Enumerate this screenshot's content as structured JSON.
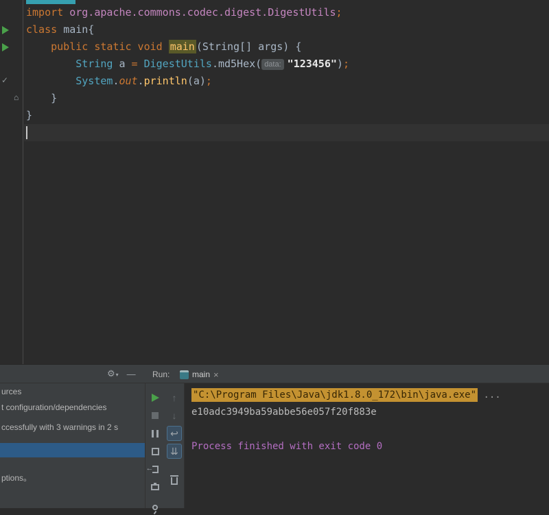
{
  "accent_colors": {
    "keyword": "#cc7832",
    "import_path": "#c586c0",
    "class_ref": "#52a5c0",
    "method": "#ffc66b",
    "run_green": "#4AA14A",
    "console_highlight_bg": "#c49231",
    "system_output_purple": "#b46ec2",
    "selection_blue": "#2d5b87",
    "active_tab_teal": "#36a0b0"
  },
  "editor": {
    "run_icon_lines": [
      1,
      2
    ],
    "gutter_marks": [
      {
        "line": 4,
        "icon": "check",
        "glyph": "✓"
      },
      {
        "line": 5,
        "icon": "bookmark",
        "glyph": "⌂"
      }
    ],
    "code_lines": [
      {
        "tokens": [
          [
            "kw",
            "import "
          ],
          [
            "imp",
            "org.apache.commons.codec.digest.DigestUtils"
          ],
          [
            "kw",
            ";"
          ]
        ]
      },
      {
        "tokens": [
          [
            "kw",
            "class "
          ],
          [
            "id",
            "main{"
          ]
        ]
      },
      {
        "tokens": [
          [
            "id",
            "    "
          ],
          [
            "kw",
            "public static void "
          ],
          [
            "decl",
            "main"
          ],
          [
            "id",
            "("
          ],
          [
            "id",
            "String[] args) {"
          ]
        ]
      },
      {
        "tokens": [
          [
            "id",
            "        "
          ],
          [
            "cls",
            "String"
          ],
          [
            "id",
            " a "
          ],
          [
            "kw",
            "= "
          ],
          [
            "cls",
            "DigestUtils"
          ],
          [
            "id",
            "."
          ],
          [
            "id",
            "md5Hex"
          ],
          [
            "id",
            "("
          ],
          [
            "chip",
            "data:"
          ],
          [
            "str",
            "\"123456\""
          ],
          [
            "id",
            ")"
          ],
          [
            "kw",
            ";"
          ]
        ]
      },
      {
        "tokens": [
          [
            "id",
            "        "
          ],
          [
            "cls",
            "System"
          ],
          [
            "id",
            "."
          ],
          [
            "fld",
            "out"
          ],
          [
            "id",
            "."
          ],
          [
            "mth",
            "println"
          ],
          [
            "id",
            "(a)"
          ],
          [
            "kw",
            ";"
          ]
        ]
      },
      {
        "tokens": [
          [
            "id",
            "    }"
          ]
        ]
      },
      {
        "tokens": [
          [
            "id",
            "}"
          ]
        ]
      }
    ]
  },
  "bottom": {
    "left_panel": {
      "gear_glyph": "⚙",
      "gear_caret": "▾",
      "hide_glyph": "—",
      "rows": [
        {
          "text": "urces",
          "selected": false
        },
        {
          "text": "t configuration/dependencies",
          "selected": false
        },
        {
          "text": "ccessfully with 3 warnings in 2 s",
          "selected": false
        },
        {
          "text": "",
          "selected": true
        },
        {
          "text": "ptions。",
          "selected": false
        }
      ]
    },
    "run_header": {
      "label": "Run:",
      "tab_label": "main",
      "close_glyph": "×"
    },
    "toolbar_col1": [
      {
        "name": "rerun-button",
        "icon": "play",
        "state": "green"
      },
      {
        "name": "stop-button",
        "icon": "stop",
        "state": "dim"
      },
      {
        "name": "pause-output-button",
        "icon": "pause",
        "state": "normal"
      },
      {
        "name": "restore-layout-button",
        "icon": "frame",
        "state": "normal"
      },
      {
        "name": "exit-button",
        "icon": "exit",
        "state": "normal"
      },
      {
        "name": "print-button",
        "icon": "print",
        "state": "normal"
      },
      {
        "name": "pin-tab-button",
        "icon": "pin",
        "state": "normal"
      }
    ],
    "toolbar_col2": [
      {
        "name": "up-stack-trace-button",
        "icon": "glyph",
        "glyph": "↑",
        "state": "dim"
      },
      {
        "name": "down-stack-trace-button",
        "icon": "glyph",
        "glyph": "↓",
        "state": "dim"
      },
      {
        "name": "soft-wrap-button",
        "icon": "glyph",
        "glyph": "↩",
        "state": "toggled"
      },
      {
        "name": "scroll-to-end-button",
        "icon": "glyph",
        "glyph": "⇊",
        "state": "toggled"
      },
      {
        "name": "clear-all-button",
        "icon": "trash",
        "state": "normal"
      }
    ],
    "console": {
      "lines": [
        {
          "type": "cmd",
          "highlighted": "\"C:\\Program Files\\Java\\jdk1.8.0_172\\bin\\java.exe\"",
          "suffix": " ..."
        },
        {
          "type": "out",
          "text": "e10adc3949ba59abbe56e057f20f883e"
        },
        {
          "type": "blank",
          "text": ""
        },
        {
          "type": "system",
          "text": "Process finished with exit code 0"
        }
      ]
    }
  }
}
